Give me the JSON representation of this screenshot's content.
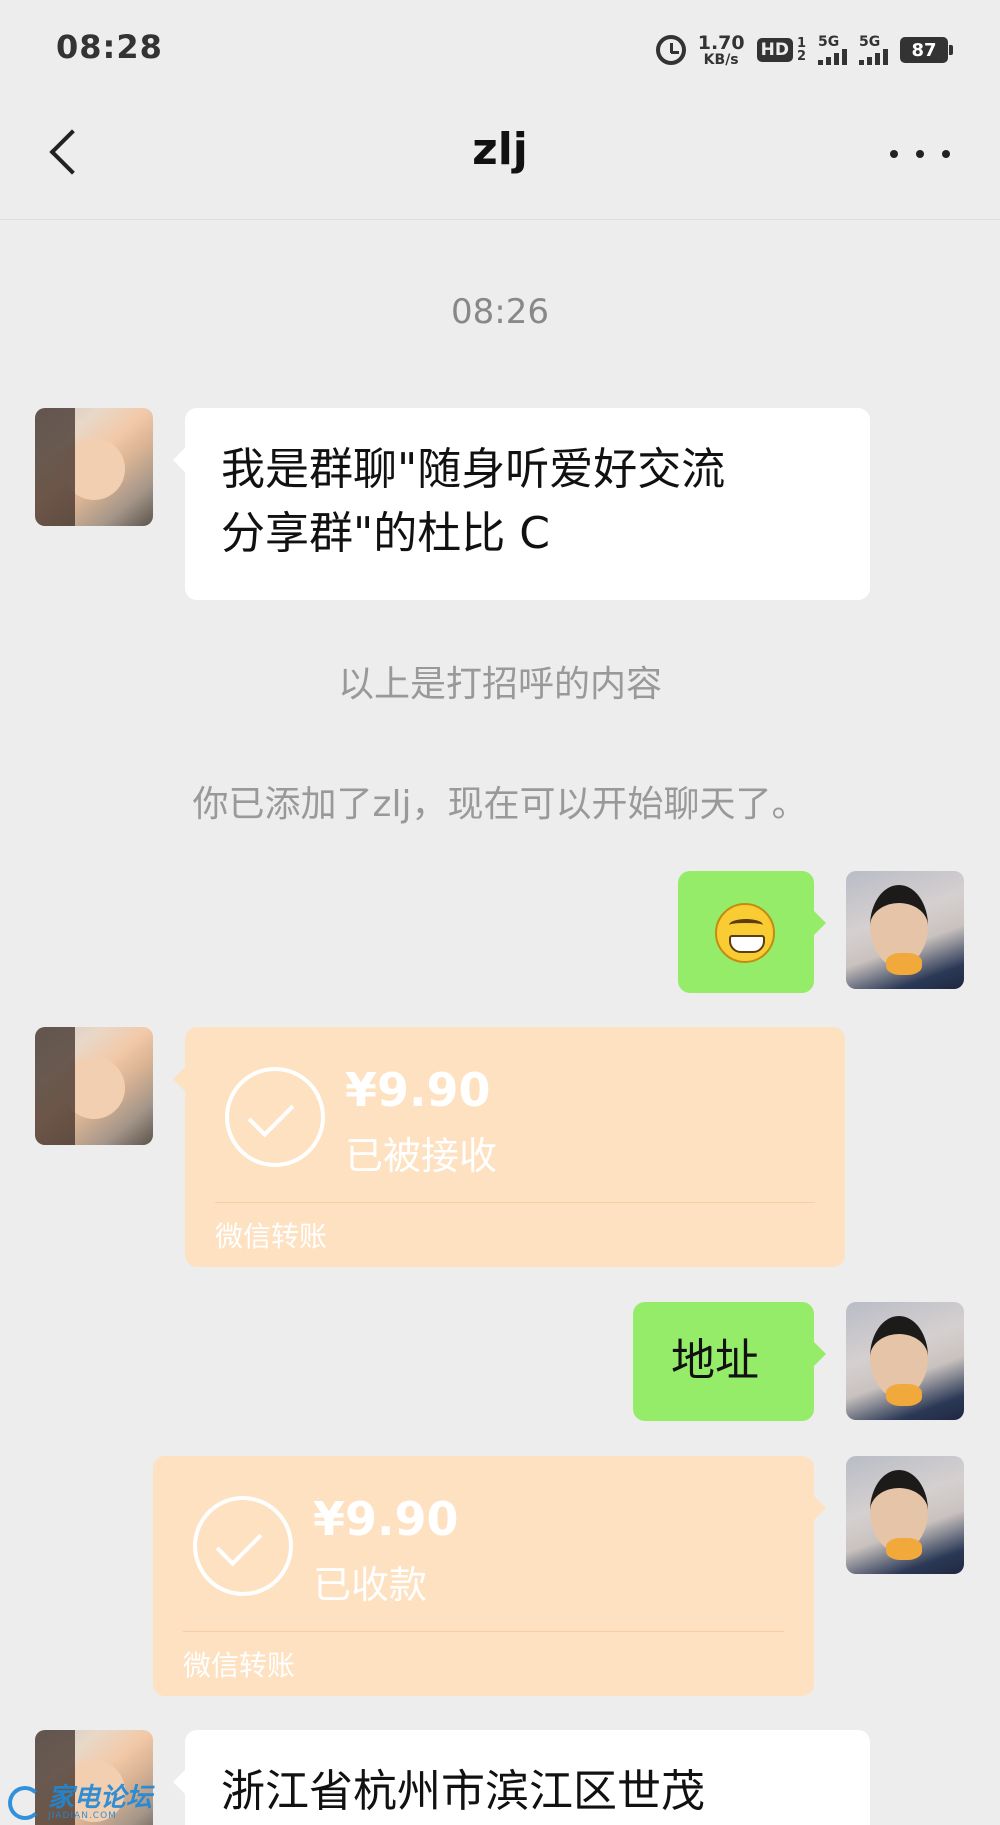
{
  "status_bar": {
    "time": "08:28",
    "net_speed_value": "1.70",
    "net_speed_unit": "KB/s",
    "hd_label": "HD",
    "hd_top": "1",
    "hd_bottom": "2",
    "sim1_label": "5G",
    "sim2_label": "5G",
    "battery": "87",
    "icons": [
      "alarm-icon",
      "signal-icon",
      "battery-icon"
    ]
  },
  "nav": {
    "title": "zlj",
    "back_icon": "chevron-left-icon",
    "more_icon": "more-dots-icon"
  },
  "chat": {
    "timestamp": "08:26",
    "greeting_line1": "我是群聊\"随身听爱好交流",
    "greeting_line2": "分享群\"的杜比 C",
    "system_greeting_note": "以上是打招呼的内容",
    "system_added_note": "你已添加了zlj，现在可以开始聊天了。",
    "emoji_message": "grinning-emoji",
    "transfer_1": {
      "amount": "¥9.90",
      "status": "已被接收",
      "footer": "微信转账"
    },
    "address_message": "地址",
    "transfer_2": {
      "amount": "¥9.90",
      "status": "已收款",
      "footer": "微信转账"
    },
    "address_reply_partial": "浙江省杭州市滨江区世茂"
  },
  "watermark": {
    "text": "家电论坛",
    "sub": "JIADIAN.COM"
  },
  "colors": {
    "background": "#ededed",
    "self_bubble": "#95ec69",
    "other_bubble": "#ffffff",
    "transfer_bubble": "#fde1c1"
  }
}
